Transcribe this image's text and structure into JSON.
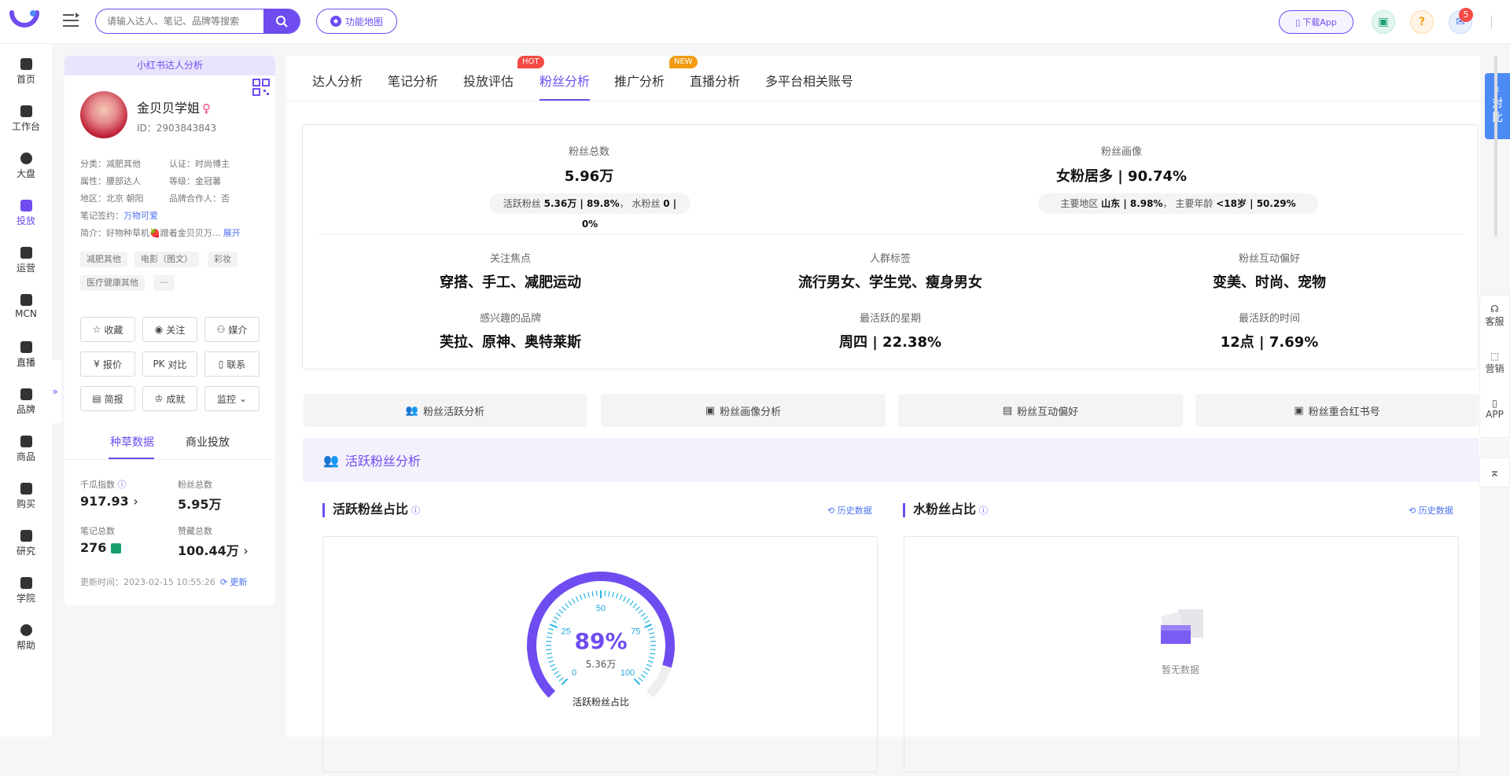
{
  "topbar": {
    "search_placeholder": "请输入达人、笔记、品牌等搜索",
    "function_map": "功能地图",
    "download_app": "下载App",
    "notification_count": "5"
  },
  "nav": [
    {
      "label": "首页",
      "icon": "home-icon"
    },
    {
      "label": "工作台",
      "icon": "workbench-icon"
    },
    {
      "label": "大盘",
      "icon": "pie-chart-icon"
    },
    {
      "label": "投放",
      "icon": "folder-icon"
    },
    {
      "label": "运营",
      "icon": "message-chart-icon"
    },
    {
      "label": "MCN",
      "icon": "building-icon"
    },
    {
      "label": "直播",
      "icon": "video-camera-icon"
    },
    {
      "label": "品牌",
      "icon": "bag-icon"
    },
    {
      "label": "商品",
      "icon": "briefcase-icon"
    },
    {
      "label": "购买",
      "icon": "cart-icon"
    },
    {
      "label": "研究",
      "icon": "flask-icon"
    },
    {
      "label": "学院",
      "icon": "graduation-cap-icon"
    },
    {
      "label": "帮助",
      "icon": "question-icon"
    }
  ],
  "profile": {
    "header": "小红书达人分析",
    "name": "金贝贝学姐",
    "gender_symbol": "♀",
    "id": "ID：2903843843",
    "category": "分类：减肥其他",
    "certification": "认证：时尚博主",
    "attribute": "属性：腰部达人",
    "level": "等级：金冠薯",
    "region": "地区：北京 朝阳",
    "brand_partner": "品牌合作人：否",
    "signing_label": "笔记签约：",
    "signing_value": "万物可爱",
    "intro": "简介：好物种草机🍓蹭着金贝贝万...",
    "expand": "展开",
    "tags": [
      "减肥其他",
      "电影（图文）",
      "彩妆",
      "医疗健康其他",
      "···"
    ],
    "buttons": [
      "收藏",
      "关注",
      "媒介",
      "报价",
      "对比",
      "联系",
      "简报",
      "成就",
      "监控"
    ],
    "tabs": [
      "种草数据",
      "商业投放"
    ],
    "stats": [
      {
        "label": "千瓜指数",
        "value": "917.93"
      },
      {
        "label": "粉丝总数",
        "value": "5.95万"
      },
      {
        "label": "笔记总数",
        "value": "276"
      },
      {
        "label": "赞藏总数",
        "value": "100.44万"
      }
    ],
    "update_time": "更新时间：2023-02-15 10:55:26",
    "update_link": "更新"
  },
  "main": {
    "tabs": [
      "达人分析",
      "笔记分析",
      "投放评估",
      "粉丝分析",
      "推广分析",
      "直播分析",
      "多平台相关账号"
    ],
    "hot_badge": "HOT",
    "new_badge": "NEW",
    "summary": {
      "total_fans_label": "粉丝总数",
      "total_fans_value": "5.96万",
      "active_fans_label": "活跃粉丝",
      "active_fans_value": "5.36万 | 89.8%",
      "water_fans_label": "水粉丝",
      "water_fans_value": "0 | 0%",
      "portrait_label": "粉丝画像",
      "portrait_value": "女粉居多 | 90.74%",
      "main_region_label": "主要地区",
      "main_region_value": "山东 | 8.98%",
      "main_age_label": "主要年龄",
      "main_age_value": "<18岁 | 50.29%",
      "items": [
        {
          "label": "关注焦点",
          "value": "穿搭、手工、减肥运动"
        },
        {
          "label": "人群标签",
          "value": "流行男女、学生党、瘦身男女"
        },
        {
          "label": "粉丝互动偏好",
          "value": "变美、时尚、宠物"
        },
        {
          "label": "感兴趣的品牌",
          "value": "芙拉、原神、奥特莱斯"
        },
        {
          "label": "最活跃的星期",
          "value": "周四 | 22.38%"
        },
        {
          "label": "最活跃的时间",
          "value": "12点 | 7.69%"
        }
      ]
    },
    "sub_buttons": [
      "粉丝活跃分析",
      "粉丝画像分析",
      "粉丝互动偏好",
      "粉丝重合红书号"
    ],
    "section_title": "活跃粉丝分析",
    "active_panel": {
      "title": "活跃粉丝占比",
      "history": "历史数据",
      "gauge_percent": "89%",
      "gauge_value": 0.898,
      "gauge_count": "5.36万",
      "gauge_caption": "活跃粉丝占比",
      "ticks": [
        "0",
        "25",
        "50",
        "75",
        "100"
      ]
    },
    "water_panel": {
      "title": "水粉丝占比",
      "history": "历史数据",
      "empty": "暂无数据"
    }
  },
  "right": {
    "compare": "对比",
    "tools": [
      "客服",
      "营销",
      "APP"
    ]
  },
  "colors": {
    "accent": "#6e4cf0",
    "link": "#4c72f0",
    "gauge_inner": "#26b5e6"
  }
}
